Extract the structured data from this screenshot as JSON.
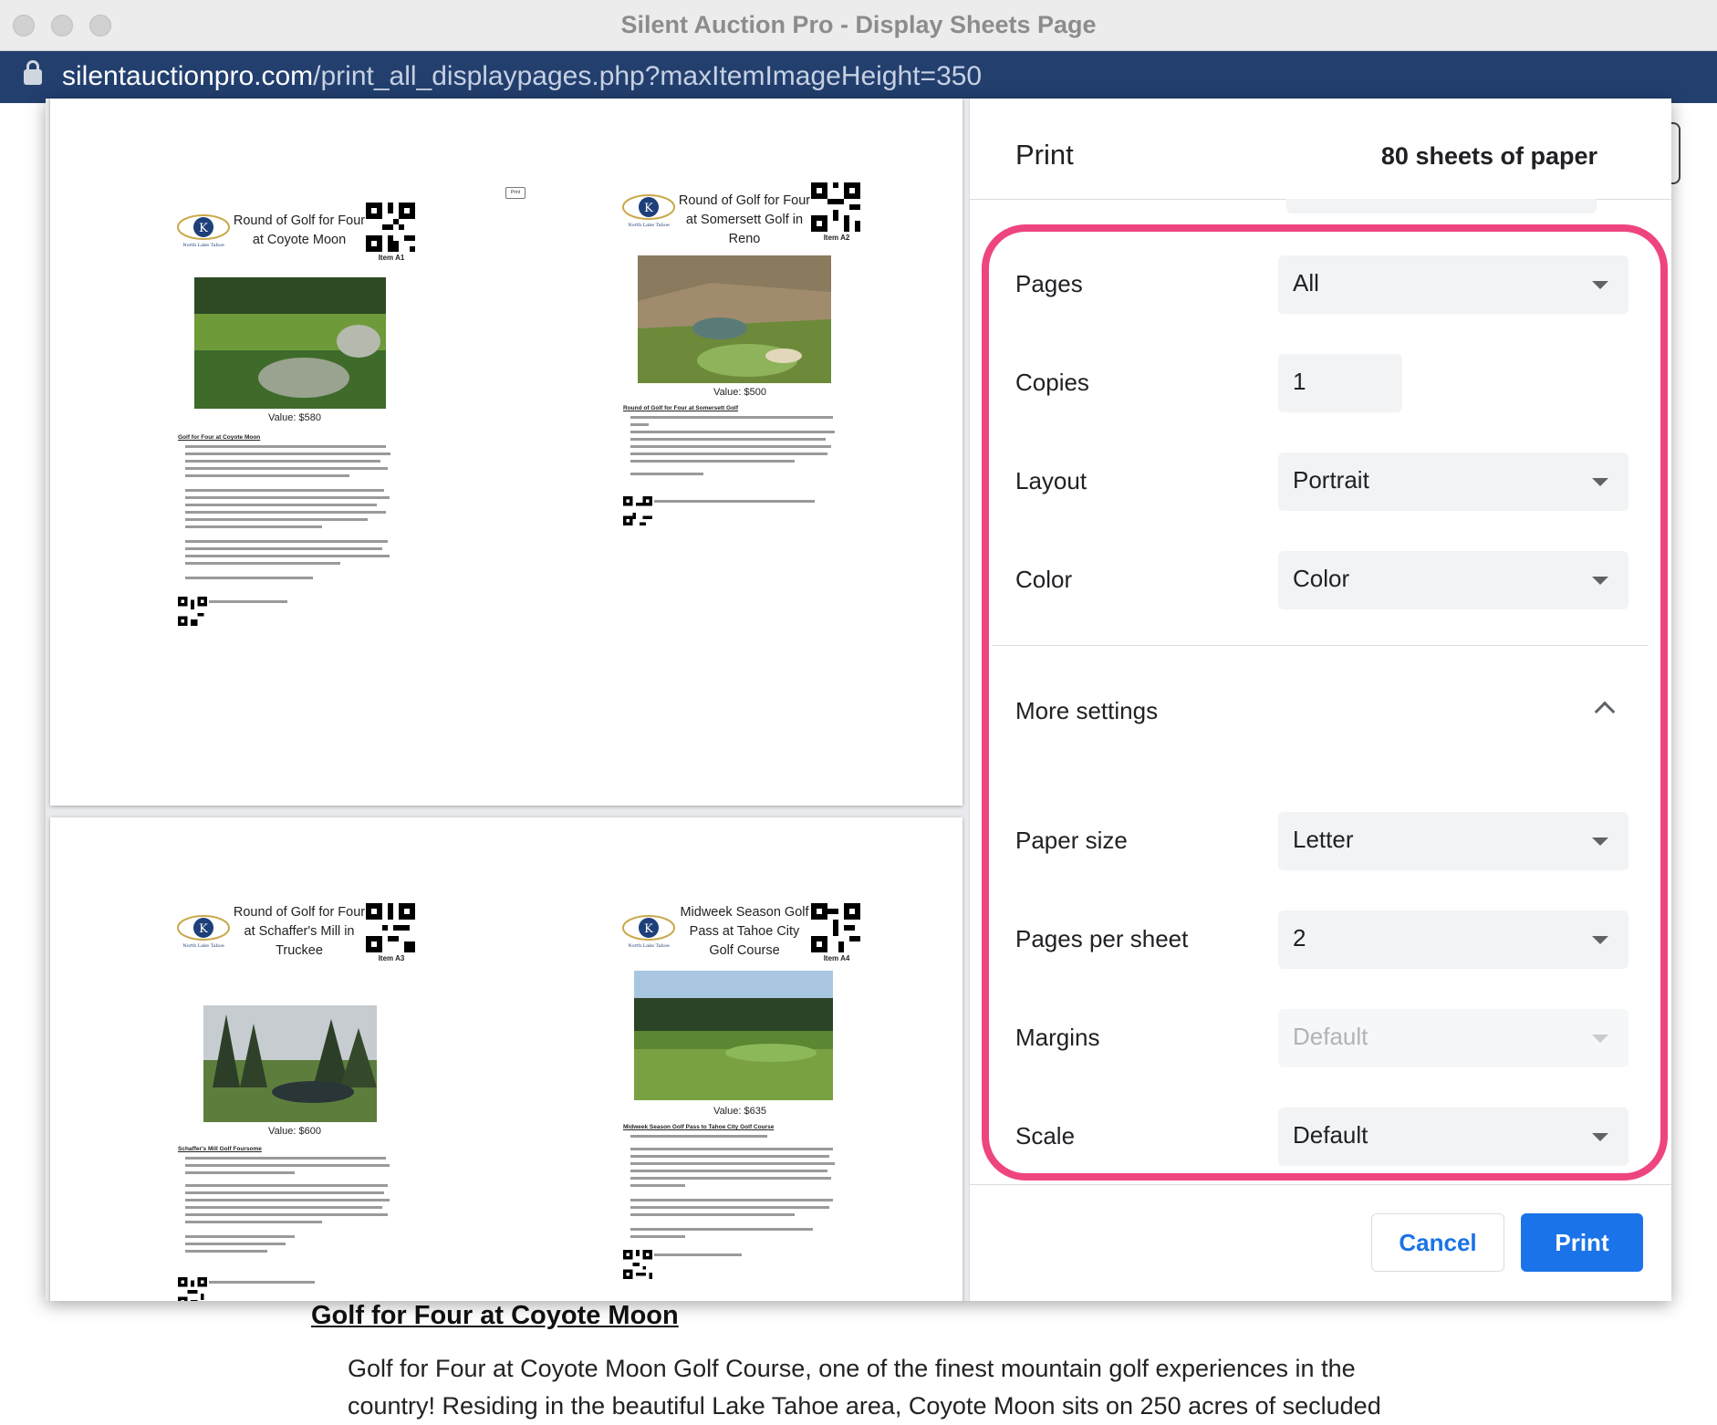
{
  "window": {
    "title": "Silent Auction Pro - Display Sheets Page"
  },
  "url": {
    "host": "silentauctionpro.com",
    "path": "/print_all_displaypages.php?maxItemImageHeight=350"
  },
  "background_page": {
    "heading": "Golf for Four at Coyote Moon",
    "body": "Golf for Four at Coyote Moon Golf Course, one of the finest mountain golf experiences in the country! Residing in the beautiful Lake Tahoe area, Coyote Moon sits on 250 acres of secluded"
  },
  "print_dialog": {
    "title": "Print",
    "sheets": "80 sheets of paper",
    "settings": {
      "pages": {
        "label": "Pages",
        "value": "All"
      },
      "copies": {
        "label": "Copies",
        "value": "1"
      },
      "layout": {
        "label": "Layout",
        "value": "Portrait"
      },
      "color": {
        "label": "Color",
        "value": "Color"
      },
      "more_settings": "More settings",
      "paper_size": {
        "label": "Paper size",
        "value": "Letter"
      },
      "pages_per_sheet": {
        "label": "Pages per sheet",
        "value": "2"
      },
      "margins": {
        "label": "Margins",
        "value": "Default"
      },
      "scale": {
        "label": "Scale",
        "value": "Default"
      }
    },
    "cancel_label": "Cancel",
    "print_label": "Print",
    "highlight_color": "#ee4581",
    "accent_color": "#1a73e8"
  },
  "preview": {
    "print_button_mini": "Print",
    "sheets": [
      {
        "items": [
          {
            "title": "Round of Golf for Four at Coyote Moon",
            "item_no": "Item A1",
            "value": "Value: $580",
            "desc_heading": "Golf for Four at Coyote Moon"
          },
          {
            "title": "Round of Golf for Four at Somersett Golf in Reno",
            "item_no": "Item A2",
            "value": "Value: $500",
            "desc_heading": "Round of Golf for Four at Somersett Golf"
          }
        ]
      },
      {
        "items": [
          {
            "title": "Round of Golf for Four at Schaffer's Mill in Truckee",
            "item_no": "Item A3",
            "value": "Value: $600",
            "desc_heading": "Schaffer's Mill Golf Foursome"
          },
          {
            "title": "Midweek Season Golf Pass at Tahoe City Golf Course",
            "item_no": "Item A4",
            "value": "Value: $635",
            "desc_heading": "Midweek Season Golf Pass to Tahoe City Golf Course"
          }
        ]
      }
    ]
  }
}
